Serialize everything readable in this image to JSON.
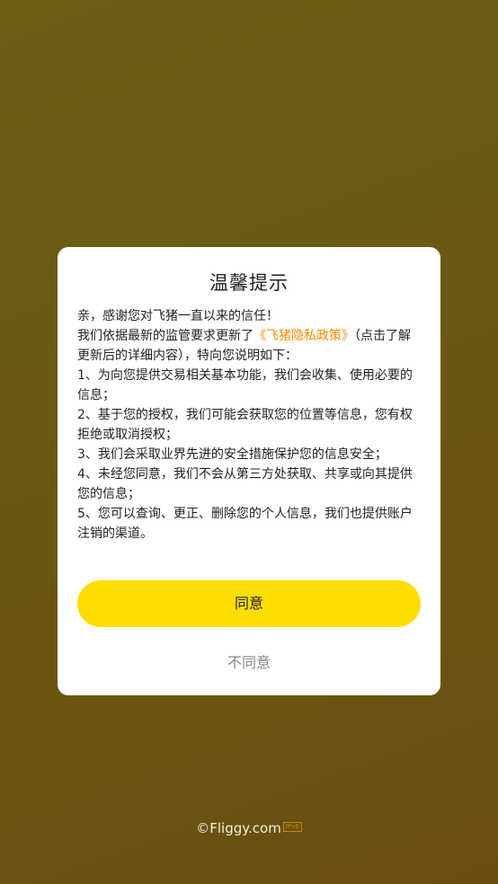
{
  "dialog": {
    "title": "温馨提示",
    "greeting": "亲，感谢您对飞猪一直以来的信任！",
    "update_prefix": "我们依据最新的监管要求更新了",
    "policy_link": "《飞猪隐私政策》",
    "update_suffix": "（点击了解更新后的详细内容），特向您说明如下：",
    "items": [
      "1、为向您提供交易相关基本功能，我们会收集、使用必要的信息；",
      "2、基于您的授权，我们可能会获取您的位置等信息，您有权拒绝或取消授权；",
      "3、我们会采取业界先进的安全措施保护您的信息安全；",
      "4、未经您同意，我们不会从第三方处获取、共享或向其提供您的信息；",
      "5、您可以查询、更正、删除您的个人信息，我们也提供账户注销的渠道。"
    ],
    "agree_label": "同意",
    "disagree_label": "不同意"
  },
  "footer": {
    "copyright": "©Fliggy.com",
    "badge": "IPv6"
  },
  "colors": {
    "accent": "#ffdd00",
    "link": "#ff8a00",
    "overlay": "#6b5a12"
  }
}
